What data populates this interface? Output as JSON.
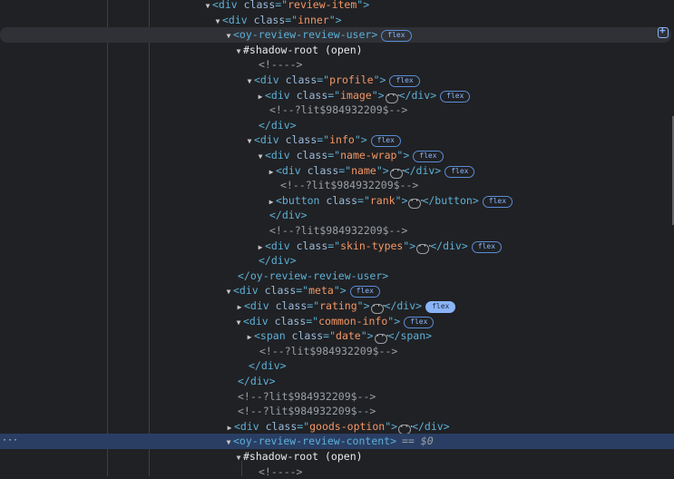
{
  "panel": "Elements",
  "selected_ref": "== $0",
  "badge": "flex",
  "lines": [
    {
      "tw": "open",
      "parts": [
        [
          "tag",
          "<div "
        ],
        [
          "an",
          "class"
        ],
        [
          "tag",
          "=\""
        ],
        [
          "av",
          "review-item"
        ],
        [
          "tag",
          "\">"
        ]
      ]
    },
    {
      "tw": "open",
      "parts": [
        [
          "tag",
          "<div "
        ],
        [
          "an",
          "class"
        ],
        [
          "tag",
          "=\""
        ],
        [
          "av",
          "inner"
        ],
        [
          "tag",
          "\">"
        ]
      ]
    },
    {
      "tw": "open",
      "parts": [
        [
          "tag",
          "<oy-review-review-user>"
        ]
      ],
      "badge": true,
      "hover": true
    },
    {
      "tw": "open",
      "parts": [
        [
          "plain",
          "#shadow-root (open)"
        ]
      ]
    },
    {
      "tw": "",
      "parts": [
        [
          "cm",
          "<!---->"
        ]
      ]
    },
    {
      "tw": "open",
      "parts": [
        [
          "tag",
          "<div "
        ],
        [
          "an",
          "class"
        ],
        [
          "tag",
          "=\""
        ],
        [
          "av",
          "profile"
        ],
        [
          "tag",
          "\">"
        ]
      ],
      "badge": true
    },
    {
      "tw": "closed",
      "parts": [
        [
          "tag",
          "<div "
        ],
        [
          "an",
          "class"
        ],
        [
          "tag",
          "=\""
        ],
        [
          "av",
          "image"
        ],
        [
          "tag",
          "\">"
        ],
        [
          "ell",
          ""
        ],
        [
          "tag",
          "</div>"
        ]
      ],
      "badge": true
    },
    {
      "tw": "",
      "parts": [
        [
          "cm",
          "<!--?lit$984932209$-->"
        ]
      ]
    },
    {
      "tw": "",
      "parts": [
        [
          "tag",
          "</div>"
        ]
      ]
    },
    {
      "tw": "open",
      "parts": [
        [
          "tag",
          "<div "
        ],
        [
          "an",
          "class"
        ],
        [
          "tag",
          "=\""
        ],
        [
          "av",
          "info"
        ],
        [
          "tag",
          "\">"
        ]
      ],
      "badge": true
    },
    {
      "tw": "open",
      "parts": [
        [
          "tag",
          "<div "
        ],
        [
          "an",
          "class"
        ],
        [
          "tag",
          "=\""
        ],
        [
          "av",
          "name-wrap"
        ],
        [
          "tag",
          "\">"
        ]
      ],
      "badge": true
    },
    {
      "tw": "closed",
      "parts": [
        [
          "tag",
          "<div "
        ],
        [
          "an",
          "class"
        ],
        [
          "tag",
          "=\""
        ],
        [
          "av",
          "name"
        ],
        [
          "tag",
          "\">"
        ],
        [
          "ell",
          ""
        ],
        [
          "tag",
          "</div>"
        ]
      ],
      "badge": true
    },
    {
      "tw": "",
      "parts": [
        [
          "cm",
          "<!--?lit$984932209$-->"
        ]
      ]
    },
    {
      "tw": "closed",
      "parts": [
        [
          "tag",
          "<button "
        ],
        [
          "an",
          "class"
        ],
        [
          "tag",
          "=\""
        ],
        [
          "av",
          "rank"
        ],
        [
          "tag",
          "\">"
        ],
        [
          "ell",
          ""
        ],
        [
          "tag",
          "</button>"
        ]
      ],
      "badge": true
    },
    {
      "tw": "",
      "parts": [
        [
          "tag",
          "</div>"
        ]
      ]
    },
    {
      "tw": "",
      "parts": [
        [
          "cm",
          "<!--?lit$984932209$-->"
        ]
      ]
    },
    {
      "tw": "closed",
      "parts": [
        [
          "tag",
          "<div "
        ],
        [
          "an",
          "class"
        ],
        [
          "tag",
          "=\""
        ],
        [
          "av",
          "skin-types"
        ],
        [
          "tag",
          "\">"
        ],
        [
          "ell",
          ""
        ],
        [
          "tag",
          "</div>"
        ]
      ],
      "badge": true
    },
    {
      "tw": "",
      "parts": [
        [
          "tag",
          "</div>"
        ]
      ]
    },
    {
      "tw": "",
      "parts": [
        [
          "tag",
          "</oy-review-review-user>"
        ]
      ]
    },
    {
      "tw": "open",
      "parts": [
        [
          "tag",
          "<div "
        ],
        [
          "an",
          "class"
        ],
        [
          "tag",
          "=\""
        ],
        [
          "av",
          "meta"
        ],
        [
          "tag",
          "\">"
        ]
      ],
      "badge": true
    },
    {
      "tw": "closed",
      "parts": [
        [
          "tag",
          "<div "
        ],
        [
          "an",
          "class"
        ],
        [
          "tag",
          "=\""
        ],
        [
          "av",
          "rating"
        ],
        [
          "tag",
          "\">"
        ],
        [
          "ell",
          ""
        ],
        [
          "tag",
          "</div>"
        ]
      ],
      "badge": true,
      "badge_active": true
    },
    {
      "tw": "open",
      "parts": [
        [
          "tag",
          "<div "
        ],
        [
          "an",
          "class"
        ],
        [
          "tag",
          "=\""
        ],
        [
          "av",
          "common-info"
        ],
        [
          "tag",
          "\">"
        ]
      ],
      "badge": true
    },
    {
      "tw": "closed",
      "parts": [
        [
          "tag",
          "<span "
        ],
        [
          "an",
          "class"
        ],
        [
          "tag",
          "=\""
        ],
        [
          "av",
          "date"
        ],
        [
          "tag",
          "\">"
        ],
        [
          "ell",
          ""
        ],
        [
          "tag",
          "</span>"
        ]
      ]
    },
    {
      "tw": "",
      "parts": [
        [
          "cm",
          "<!--?lit$984932209$-->"
        ]
      ]
    },
    {
      "tw": "",
      "parts": [
        [
          "tag",
          "</div>"
        ]
      ]
    },
    {
      "tw": "",
      "parts": [
        [
          "tag",
          "</div>"
        ]
      ]
    },
    {
      "tw": "",
      "parts": [
        [
          "cm",
          "<!--?lit$984932209$-->"
        ]
      ]
    },
    {
      "tw": "",
      "parts": [
        [
          "cm",
          "<!--?lit$984932209$-->"
        ]
      ]
    },
    {
      "tw": "closed",
      "parts": [
        [
          "tag",
          "<div "
        ],
        [
          "an",
          "class"
        ],
        [
          "tag",
          "=\""
        ],
        [
          "av",
          "goods-option"
        ],
        [
          "tag",
          "\">"
        ],
        [
          "ell",
          ""
        ],
        [
          "tag",
          "</div>"
        ]
      ]
    },
    {
      "tw": "open",
      "parts": [
        [
          "tag",
          "<oy-review-review-content>"
        ]
      ],
      "selected": true
    },
    {
      "tw": "open",
      "parts": [
        [
          "plain",
          "#shadow-root (open)"
        ]
      ]
    },
    {
      "tw": "",
      "parts": [
        [
          "cm",
          "<!---->"
        ]
      ]
    }
  ]
}
